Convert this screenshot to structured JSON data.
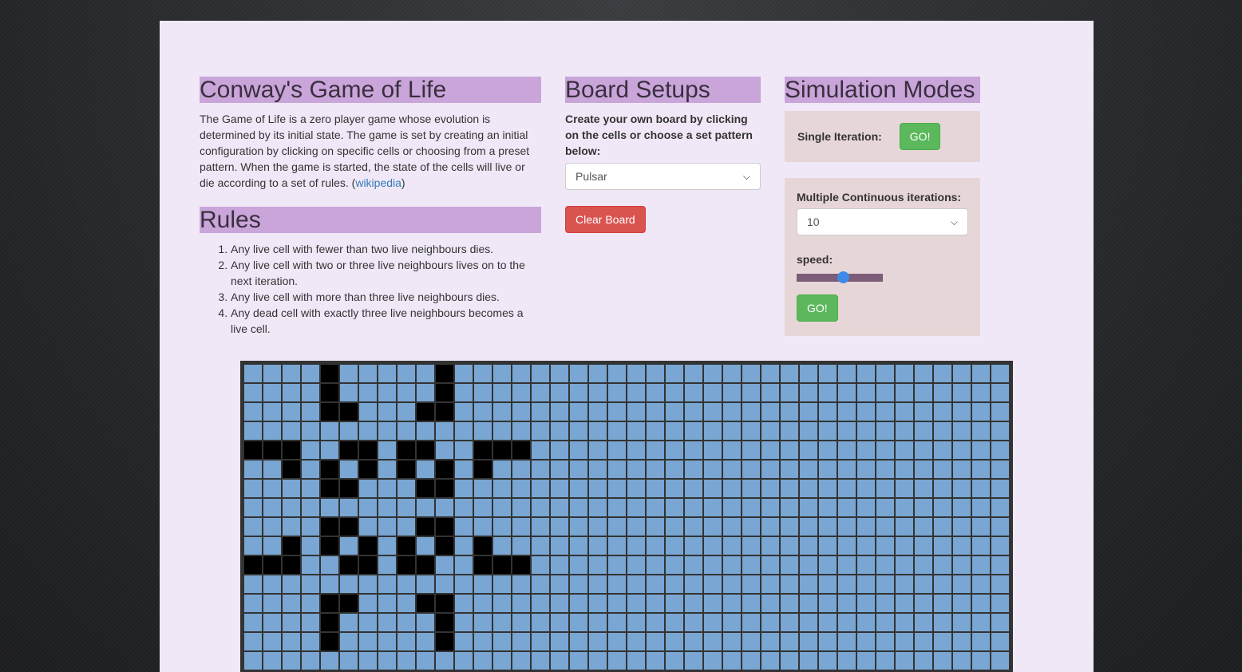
{
  "intro": {
    "title": "Conway's Game of Life",
    "description": "The Game of Life is a zero player game whose evolution is determined by its initial state. The game is set by creating an initial configuration by clicking on specific cells or choosing from a preset pattern. When the game is started, the state of the cells will live or die according to a set of rules. (",
    "link_text": "wikipedia",
    "description_end": ")"
  },
  "rules": {
    "title": "Rules",
    "items": [
      "Any live cell with fewer than two live neighbours dies.",
      "Any live cell with two or three live neighbours lives on to the next iteration.",
      "Any live cell with more than three live neighbours dies.",
      "Any dead cell with exactly three live neighbours becomes a live cell."
    ]
  },
  "board_setups": {
    "title": "Board Setups",
    "instruction": "Create your own board by clicking on the cells or choose a set pattern below:",
    "pattern_selected": "Pulsar",
    "clear_label": "Clear Board"
  },
  "simulation": {
    "title": "Simulation Modes",
    "single_label": "Single Iteration:",
    "single_go": "GO!",
    "multi_label": "Multiple Continuous iterations:",
    "iterations_selected": "10",
    "speed_label": "speed:",
    "speed_value": 0.55,
    "multi_go": "GO!"
  },
  "colors": {
    "heading_bg": "#c9a5da",
    "page_bg": "#f0e8f7",
    "panel_bg": "#e7d6d7",
    "cell_dead": "#79a6d2",
    "cell_alive": "#000000",
    "danger": "#d9534f",
    "success": "#5cb85c"
  },
  "board": {
    "columns": 40,
    "visible_rows": 16,
    "alive_cells": [
      [
        0,
        4
      ],
      [
        0,
        10
      ],
      [
        1,
        4
      ],
      [
        1,
        10
      ],
      [
        2,
        4
      ],
      [
        2,
        5
      ],
      [
        2,
        9
      ],
      [
        2,
        10
      ],
      [
        4,
        0
      ],
      [
        4,
        1
      ],
      [
        4,
        2
      ],
      [
        4,
        5
      ],
      [
        4,
        6
      ],
      [
        4,
        8
      ],
      [
        4,
        9
      ],
      [
        4,
        12
      ],
      [
        4,
        13
      ],
      [
        4,
        14
      ],
      [
        5,
        2
      ],
      [
        5,
        4
      ],
      [
        5,
        6
      ],
      [
        5,
        8
      ],
      [
        5,
        10
      ],
      [
        5,
        12
      ],
      [
        6,
        4
      ],
      [
        6,
        5
      ],
      [
        6,
        9
      ],
      [
        6,
        10
      ],
      [
        8,
        4
      ],
      [
        8,
        5
      ],
      [
        8,
        9
      ],
      [
        8,
        10
      ],
      [
        9,
        2
      ],
      [
        9,
        4
      ],
      [
        9,
        6
      ],
      [
        9,
        8
      ],
      [
        9,
        10
      ],
      [
        9,
        12
      ],
      [
        10,
        0
      ],
      [
        10,
        1
      ],
      [
        10,
        2
      ],
      [
        10,
        5
      ],
      [
        10,
        6
      ],
      [
        10,
        8
      ],
      [
        10,
        9
      ],
      [
        10,
        12
      ],
      [
        10,
        13
      ],
      [
        10,
        14
      ],
      [
        12,
        4
      ],
      [
        12,
        5
      ],
      [
        12,
        9
      ],
      [
        12,
        10
      ],
      [
        13,
        4
      ],
      [
        13,
        10
      ],
      [
        14,
        4
      ],
      [
        14,
        10
      ]
    ]
  }
}
